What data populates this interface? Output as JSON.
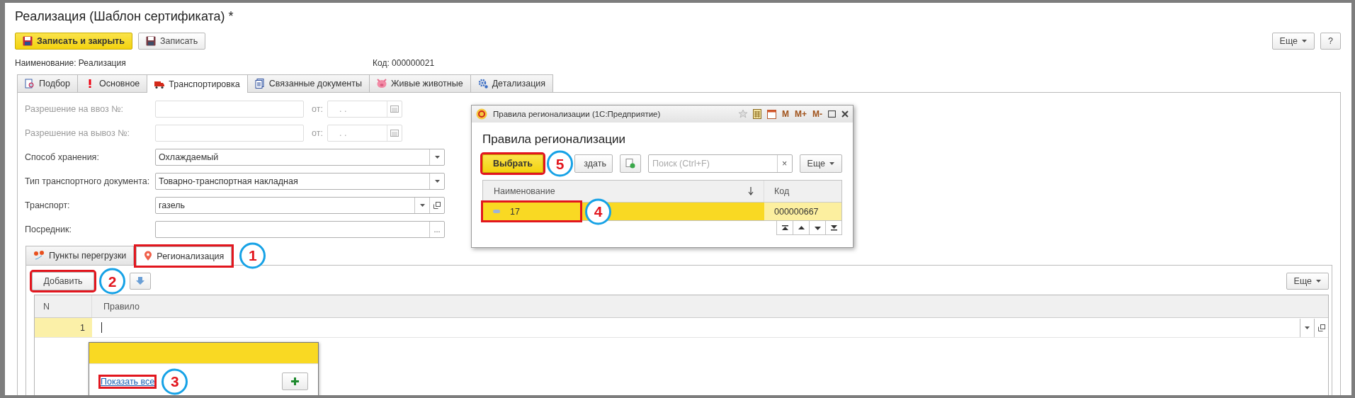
{
  "window": {
    "title": "Реализация (Шаблон сертификата) *"
  },
  "command_bar": {
    "buttons": [
      {
        "label": "Записать и закрыть",
        "kind": "primary"
      },
      {
        "label": "Записать",
        "kind": "default"
      }
    ],
    "more": "Еще",
    "help": "?"
  },
  "info": {
    "name": "Наименование: Реализация",
    "code": "Код: 000000021"
  },
  "tabs": [
    {
      "label": "Подбор",
      "selected": false
    },
    {
      "label": "Основное",
      "selected": false
    },
    {
      "label": "Транспортировка",
      "selected": true
    },
    {
      "label": "Связанные документы",
      "selected": false
    },
    {
      "label": "Живые животные",
      "selected": false
    },
    {
      "label": "Детализация",
      "selected": false
    }
  ],
  "fields": [
    {
      "label": "Разрешение на ввоз №:",
      "kind": "permit",
      "disabled": true,
      "date_label": "от:",
      "date_value": ". ."
    },
    {
      "label": "Разрешение на вывоз №:",
      "kind": "permit",
      "disabled": true,
      "date_label": "от:",
      "date_value": ". ."
    },
    {
      "label": "Способ хранения:",
      "kind": "select",
      "disabled": false,
      "value": "Охлаждаемый"
    },
    {
      "label": "Тип транспортного документа:",
      "kind": "select",
      "disabled": false,
      "value": "Товарно-транспортная накладная"
    },
    {
      "label": "Транспорт:",
      "kind": "reference",
      "disabled": false,
      "value": "газель"
    },
    {
      "label": "Посредник:",
      "kind": "choice",
      "disabled": false,
      "button": "..."
    }
  ],
  "subtabs": [
    {
      "label": "Пункты перегрузки",
      "selected": false,
      "highlighted": false
    },
    {
      "label": "Регионализация",
      "selected": true,
      "highlighted": true,
      "callout": "1"
    }
  ],
  "list_toolbar": {
    "add": {
      "label": "Добавить",
      "highlighted": true,
      "callout": "2"
    },
    "more": "Еще"
  },
  "table": {
    "columns": [
      "N",
      "Правило"
    ],
    "rows": [
      {
        "n": "1",
        "selected": true,
        "editing": true
      }
    ]
  },
  "dropdown": {
    "rows": [
      {
        "selected": true
      }
    ],
    "show_all": {
      "label": "Показать все",
      "highlighted": true,
      "callout": "3"
    }
  },
  "dialog": {
    "title": "Правила регионализации  (1С:Предприятие)",
    "title_buttons": [
      "M",
      "M+",
      "M-"
    ],
    "heading": "Правила регионализации",
    "choose": {
      "label": "Выбрать",
      "highlighted": true,
      "callout": "5"
    },
    "create": "здать",
    "search": {
      "placeholder": "Поиск (Ctrl+F)"
    },
    "clear": "×",
    "more": "Еще",
    "columns": [
      "Наименование",
      "Код"
    ],
    "rows": [
      {
        "name": "17",
        "code": "000000667",
        "selected": true,
        "highlighted": true,
        "callout": "4"
      }
    ]
  }
}
